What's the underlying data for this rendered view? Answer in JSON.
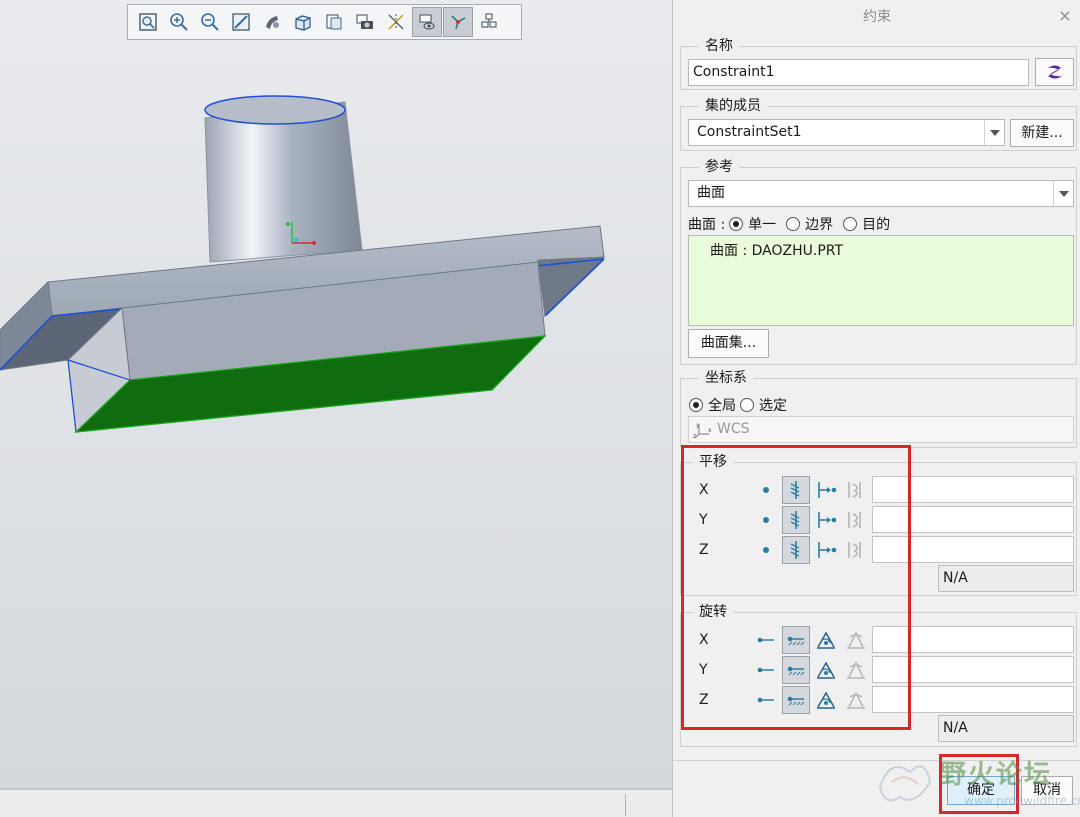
{
  "dialog": {
    "title": "约束",
    "close_glyph": "×",
    "name_section": {
      "legend": "名称",
      "value": "Constraint1"
    },
    "set_section": {
      "legend": "集的成员",
      "selected": "ConstraintSet1",
      "new_button": "新建..."
    },
    "reference_section": {
      "legend": "参考",
      "type_selected": "曲面",
      "mode_label": "曲面 :",
      "options": [
        "单一",
        "边界",
        "目的"
      ],
      "selected_option": "单一",
      "items": [
        "曲面 : DAOZHU.PRT"
      ],
      "surface_set_button": "曲面集..."
    },
    "csys_section": {
      "legend": "坐标系",
      "options": [
        "全局",
        "选定"
      ],
      "selected_option": "全局",
      "csys_value": "WCS"
    },
    "translation_section": {
      "legend": "平移",
      "axes": [
        "X",
        "Y",
        "Z"
      ],
      "status": "N/A"
    },
    "rotation_section": {
      "legend": "旋转",
      "axes": [
        "X",
        "Y",
        "Z"
      ],
      "status": "N/A"
    },
    "ok_button": "确定",
    "cancel_button": "取消"
  },
  "toolbar": {
    "icons": [
      "zoom-fit-icon",
      "zoom-in-icon",
      "zoom-out-icon",
      "repaint-icon",
      "display-style-icon",
      "saved-views-icon",
      "view-manager-icon",
      "camera-icon",
      "datum-display-icon",
      "constraint-display-icon",
      "load-display-icon",
      "mesh-display-icon"
    ]
  },
  "watermark": {
    "text": "野火论坛",
    "url": "www.proewildfire.cn"
  },
  "colors": {
    "highlight_red": "#d22a2a",
    "reference_list_bg": "#e9fbd9",
    "model_face_green": "#0f6d0f",
    "edge_blue": "#1a4fd6"
  }
}
